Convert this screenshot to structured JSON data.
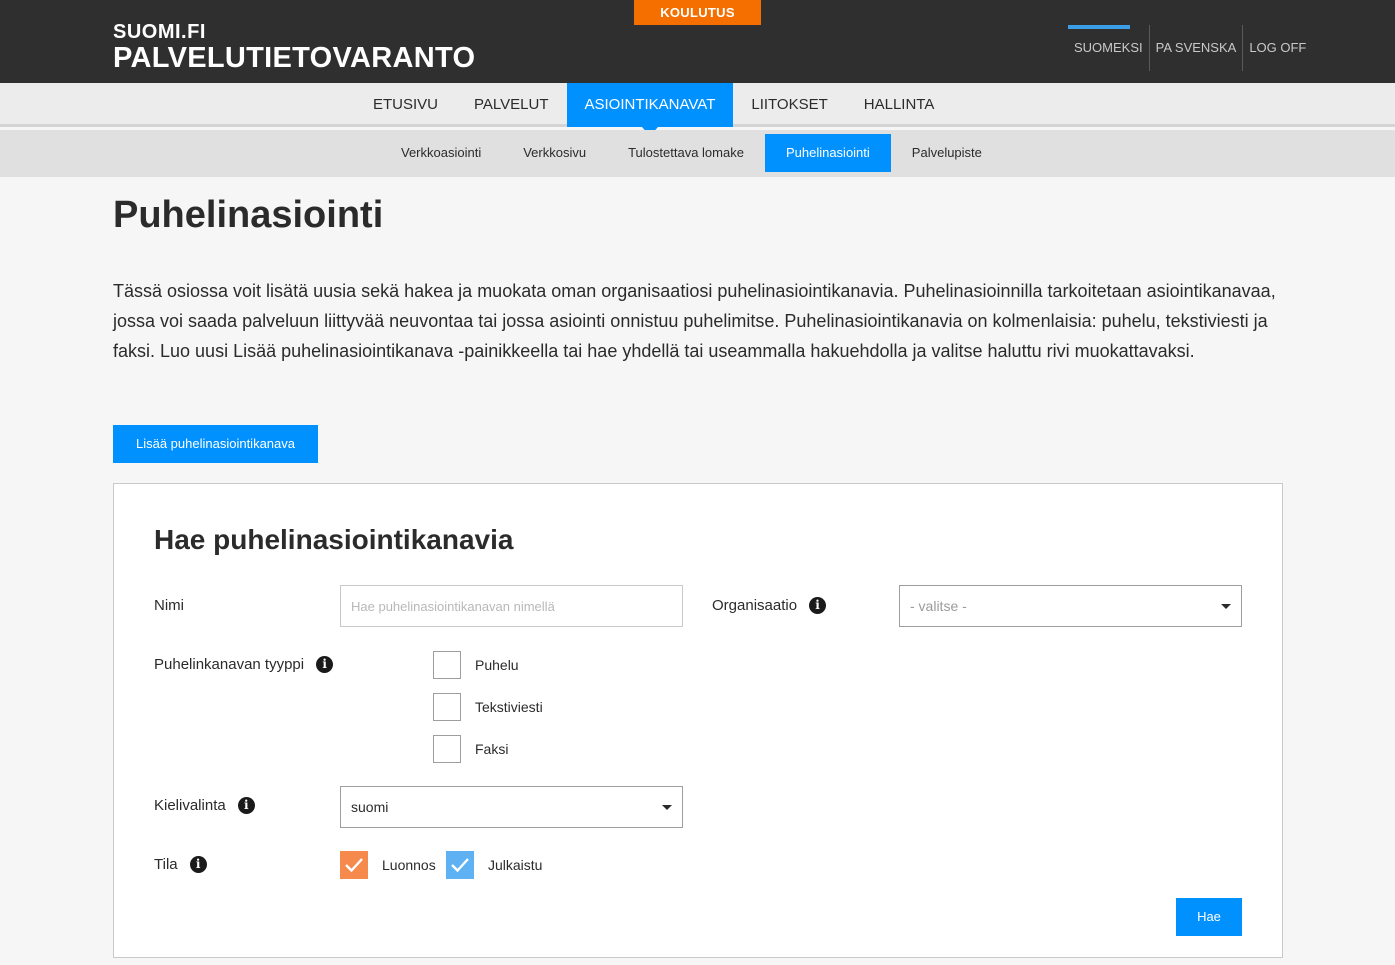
{
  "header": {
    "logo_line1": "SUOMI.FI",
    "logo_line2": "PALVELUTIETOVARANTO",
    "env_badge": "KOULUTUS",
    "languages": [
      "SUOMEKSI",
      "PA SVENSKA",
      "LOG OFF"
    ]
  },
  "main_nav": [
    "ETUSIVU",
    "PALVELUT",
    "ASIOINTIKANAVAT",
    "LIITOKSET",
    "HALLINTA"
  ],
  "sub_nav": [
    "Verkkoasiointi",
    "Verkkosivu",
    "Tulostettava lomake",
    "Puhelinasiointi",
    "Palvelupiste"
  ],
  "page": {
    "title": "Puhelinasiointi",
    "intro": "Tässä osiossa voit lisätä uusia sekä hakea ja muokata oman organisaatiosi puhelinasiointikanavia. Puhelinasioinnilla tarkoitetaan asiointikanavaa, jossa voi saada palveluun liittyvää neuvontaa tai jossa asiointi onnistuu puhelimitse. Puhelinasiointikanavia on kolmenlaisia: puhelu, tekstiviesti ja faksi. Luo uusi Lisää puhelinasiointikanava -painikkeella tai hae yhdellä tai useammalla hakuehdolla ja valitse haluttu rivi muokattavaksi.",
    "add_button": "Lisää puhelinasiointikanava"
  },
  "search": {
    "title": "Hae puhelinasiointikanavia",
    "name_label": "Nimi",
    "name_placeholder": "Hae puhelinasiointikanavan nimellä",
    "org_label": "Organisaatio",
    "org_placeholder": "- valitse -",
    "type_label": "Puhelinkanavan tyyppi",
    "types": [
      "Puhelu",
      "Tekstiviesti",
      "Faksi"
    ],
    "language_label": "Kielivalinta",
    "language_value": "suomi",
    "status_label": "Tila",
    "statuses": [
      "Luonnos",
      "Julkaistu"
    ],
    "search_button": "Hae"
  },
  "colors": {
    "accent": "#0091ff",
    "env_badge": "#f46f00",
    "draft_check": "#f68a4d",
    "published_check": "#5eb2f3"
  },
  "icons": {
    "info": "info-circle-icon",
    "dropdown": "caret-down-icon",
    "check": "checkmark-icon"
  }
}
